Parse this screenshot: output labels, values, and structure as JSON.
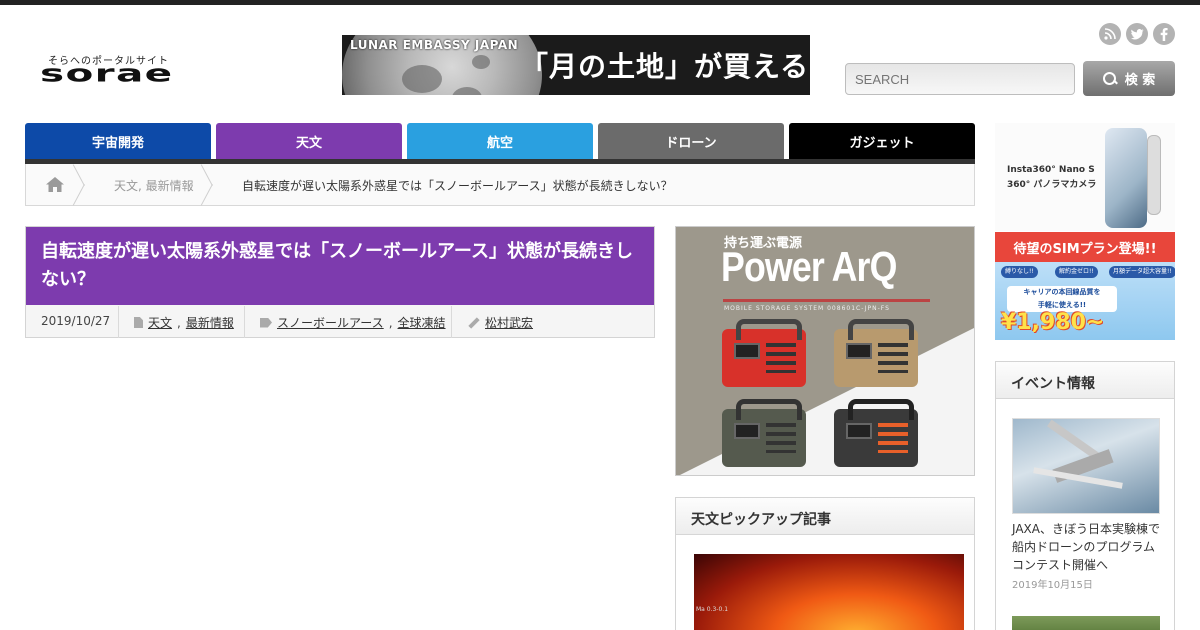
{
  "header": {
    "logo_tagline": "そらへのポータルサイト",
    "logo_word": "sorae",
    "banner": {
      "brand": "LUNAR EMBASSY JAPAN",
      "headline": "「月の土地」が買える！"
    },
    "social": {
      "rss": "RSS",
      "twitter": "t",
      "facebook": "f"
    },
    "search": {
      "placeholder": "SEARCH",
      "button_label": "検 索"
    }
  },
  "nav": {
    "items": [
      {
        "label": "宇宙開発",
        "color": "#0d4aa8"
      },
      {
        "label": "天文",
        "color": "#7d3bae"
      },
      {
        "label": "航空",
        "color": "#2aa0e0"
      },
      {
        "label": "ドローン",
        "color": "#6b6b6b"
      },
      {
        "label": "ガジェット",
        "color": "#000000"
      }
    ]
  },
  "breadcrumb": {
    "category": "天文, 最新情報",
    "current": "自転速度が遅い太陽系外惑星では「スノーボールアース」状態が長続きしない？"
  },
  "article": {
    "title": "自転速度が遅い太陽系外惑星では「スノーボールアース」状態が長続きしない？",
    "date": "2019/10/27",
    "categories": [
      "天文",
      "最新情報"
    ],
    "tags": [
      "スノーボールアース",
      "全球凍結"
    ],
    "author": "松村武宏"
  },
  "ads": {
    "power": {
      "subtitle": "持ち運ぶ電源",
      "name": "Power ArQ",
      "model": "MOBILE STORAGE SYSTEM 008601C-JPN-FS"
    },
    "insta": {
      "line1": "Insta360° Nano S",
      "line2": "360° パノラマカメラ"
    },
    "sim": {
      "top": "待望のSIMプラン登場!!",
      "pill1": "縛りなし!!",
      "pill2": "解約金ゼロ!!",
      "pill3": "月額データ超大容量!!",
      "mid1": "キャリアの本回線品質を",
      "mid2": "手軽に使える!!",
      "price": "¥1,980~"
    }
  },
  "widgets": {
    "pickup": {
      "title": "天文ピックアップ記事",
      "image_label": "Ma 0.3-0.1"
    },
    "events": {
      "title": "イベント情報",
      "item_title": "JAXA、きぼう日本実験棟で船内ドローンのプログラムコンテスト開催へ",
      "item_date": "2019年10月15日"
    }
  }
}
